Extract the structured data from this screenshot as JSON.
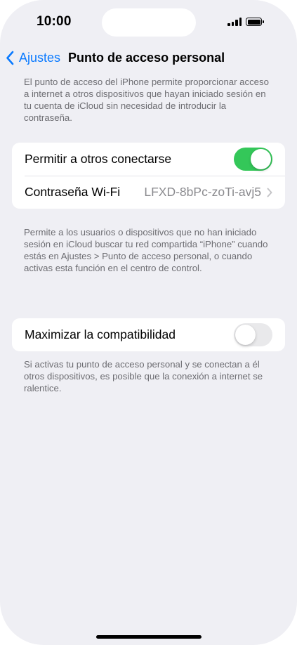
{
  "status_bar": {
    "time": "10:00",
    "signal_bars": 4,
    "battery_level": 1.0
  },
  "nav": {
    "back_label": "Ajustes",
    "title": "Punto de acceso personal"
  },
  "intro_text": "El punto de acceso del iPhone permite proporcionar acceso a internet a otros dispositivos que hayan iniciado sesión en tu cuenta de iCloud sin necesidad de introducir la contraseña.",
  "group1": {
    "allow_others_label": "Permitir a otros conectarse",
    "allow_others_on": true,
    "wifi_password_label": "Contraseña Wi-Fi",
    "wifi_password_value": "LFXD-8bPc-zoTi-avj5",
    "footer": "Permite a los usuarios o dispositivos que no han iniciado sesión en iCloud buscar tu red compartida “iPhone” cuando estás en Ajustes > Punto de acceso personal, o cuando activas esta función en el centro de control."
  },
  "group2": {
    "maximize_label": "Maximizar la compatibilidad",
    "maximize_on": false,
    "footer": "Si activas tu punto de acceso personal y se conectan a él otros dispositivos, es posible que la conexión a internet se ralentice."
  },
  "colors": {
    "accent": "#0a7aff",
    "toggle_on": "#34c759",
    "toggle_off": "#e9e9eb",
    "background": "#efeff4"
  },
  "icons": {
    "back": "chevron-left-icon",
    "disclosure": "chevron-right-icon"
  }
}
